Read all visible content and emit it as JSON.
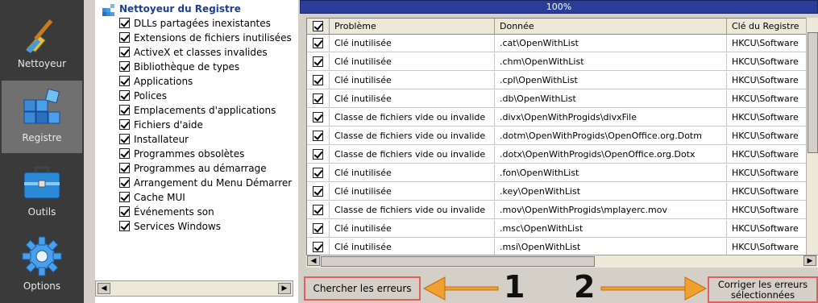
{
  "sidebar": {
    "items": [
      {
        "label": "Nettoyeur",
        "icon": "broom-icon",
        "active": false
      },
      {
        "label": "Registre",
        "icon": "registry-cubes-icon",
        "active": true
      },
      {
        "label": "Outils",
        "icon": "toolbox-icon",
        "active": false
      },
      {
        "label": "Options",
        "icon": "gear-icon",
        "active": false
      }
    ]
  },
  "tree": {
    "title": "Nettoyeur du Registre",
    "items": [
      "DLLs partagées inexistantes",
      "Extensions de fichiers inutilisées",
      "ActiveX et classes invalides",
      "Bibliothèque de types",
      "Applications",
      "Polices",
      "Emplacements d'applications",
      "Fichiers d'aide",
      "Installateur",
      "Programmes obsolètes",
      "Programmes au démarrage",
      "Arrangement du Menu Démarrer",
      "Cache MUI",
      "Événements son",
      "Services Windows"
    ]
  },
  "progress": {
    "text": "100%",
    "value": 1.0
  },
  "grid": {
    "columns": [
      "Problème",
      "Donnée",
      "Clé du Registre"
    ],
    "rows": [
      [
        "Clé inutilisée",
        ".cat\\OpenWithList",
        "HKCU\\Software"
      ],
      [
        "Clé inutilisée",
        ".chm\\OpenWithList",
        "HKCU\\Software"
      ],
      [
        "Clé inutilisée",
        ".cpl\\OpenWithList",
        "HKCU\\Software"
      ],
      [
        "Clé inutilisée",
        ".db\\OpenWithList",
        "HKCU\\Software"
      ],
      [
        "Classe de fichiers vide ou invalide",
        ".divx\\OpenWithProgids\\divxFile",
        "HKCU\\Software"
      ],
      [
        "Classe de fichiers vide ou invalide",
        ".dotm\\OpenWithProgids\\OpenOffice.org.Dotm",
        "HKCU\\Software"
      ],
      [
        "Classe de fichiers vide ou invalide",
        ".dotx\\OpenWithProgids\\OpenOffice.org.Dotx",
        "HKCU\\Software"
      ],
      [
        "Clé inutilisée",
        ".fon\\OpenWithList",
        "HKCU\\Software"
      ],
      [
        "Clé inutilisée",
        ".key\\OpenWithList",
        "HKCU\\Software"
      ],
      [
        "Classe de fichiers vide ou invalide",
        ".mov\\OpenWithProgids\\mplayerc.mov",
        "HKCU\\Software"
      ],
      [
        "Clé inutilisée",
        ".msc\\OpenWithList",
        "HKCU\\Software"
      ],
      [
        "Clé inutilisée",
        ".msi\\OpenWithList",
        "HKCU\\Software"
      ]
    ]
  },
  "actions": {
    "scan_label": "Chercher les erreurs",
    "fix_label_line1": "Corriger les erreurs",
    "fix_label_line2": "sélectionnées"
  },
  "annotations": {
    "num1": "1",
    "num2": "2",
    "arrow_color": "#f0a030"
  }
}
